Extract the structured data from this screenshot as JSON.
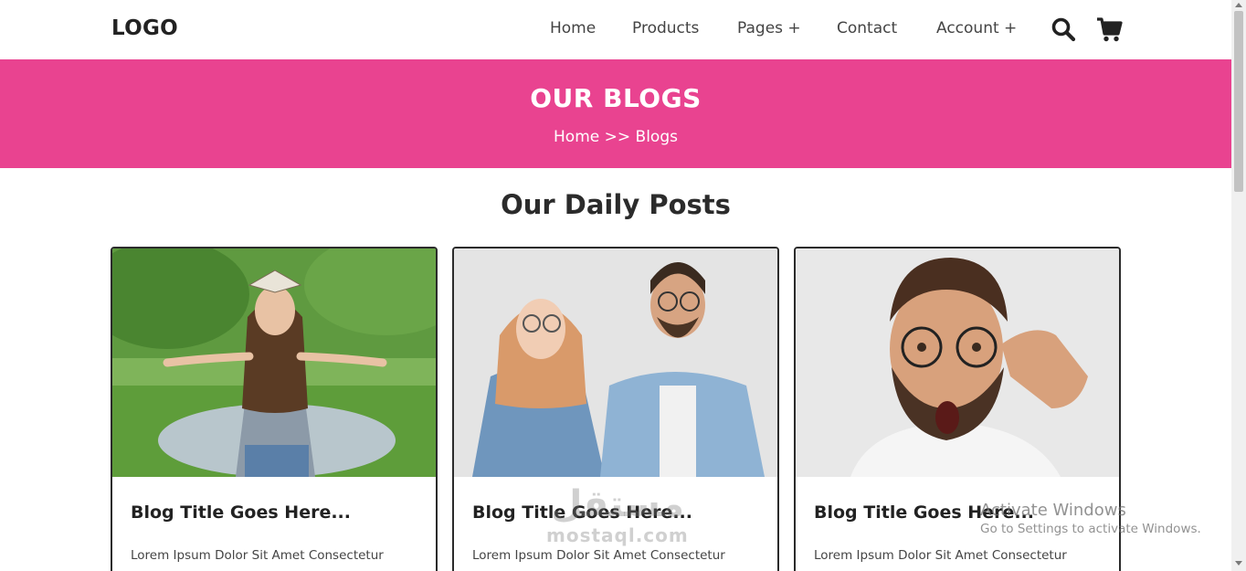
{
  "header": {
    "logo": "LOGO",
    "nav": [
      {
        "label": "Home"
      },
      {
        "label": "Products"
      },
      {
        "label": "Pages +"
      },
      {
        "label": "Contact"
      },
      {
        "label": "Account +"
      }
    ],
    "search_icon": "search-icon",
    "cart_icon": "shopping-cart-icon"
  },
  "banner": {
    "title": "OUR BLOGS",
    "breadcrumb": {
      "home": "Home",
      "separator": ">>",
      "current": "Blogs"
    },
    "color": "#e94390"
  },
  "section": {
    "title": "Our Daily Posts"
  },
  "cards": [
    {
      "title": "Blog Title Goes Here...",
      "text": "Lorem Ipsum Dolor Sit Amet Consectetur",
      "image": "girl-with-book-on-head-photo"
    },
    {
      "title": "Blog Title Goes Here...",
      "text": "Lorem Ipsum Dolor Sit Amet Consectetur",
      "image": "thinking-couple-photo"
    },
    {
      "title": "Blog Title Goes Here...",
      "text": "Lorem Ipsum Dolor Sit Amet Consectetur",
      "image": "surprised-man-with-glasses-photo"
    }
  ],
  "watermark": {
    "arabic": "مستقل",
    "latin": "mostaql.com"
  },
  "activation": {
    "line1": "Activate Windows",
    "line2": "Go to Settings to activate Windows."
  }
}
